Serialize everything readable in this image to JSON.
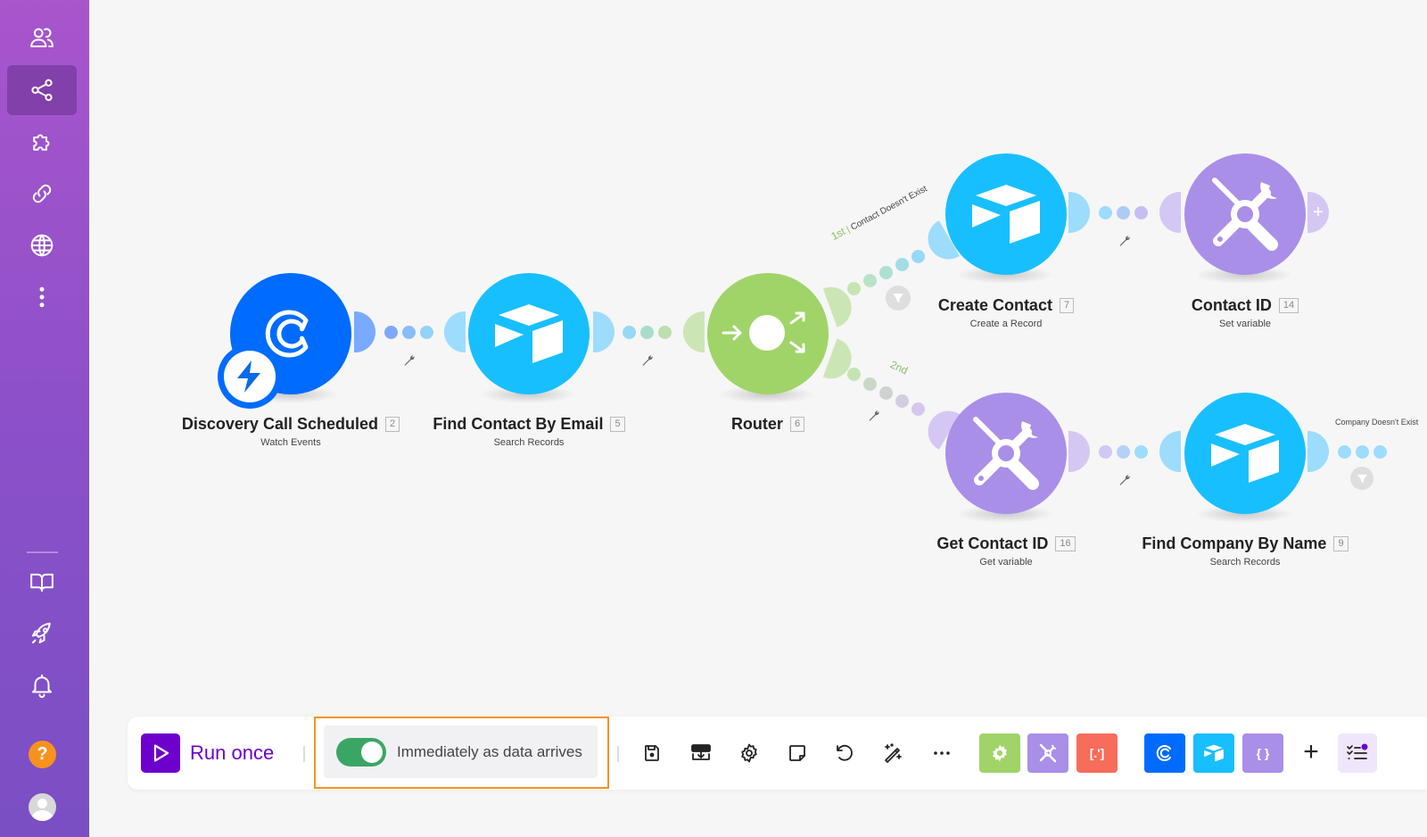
{
  "sidebar": {
    "items": [
      {
        "name": "team",
        "icon": "users-icon"
      },
      {
        "name": "scenarios",
        "icon": "share-icon",
        "active": true
      },
      {
        "name": "templates",
        "icon": "puzzle-icon"
      },
      {
        "name": "connections",
        "icon": "link-icon"
      },
      {
        "name": "webhooks",
        "icon": "globe-icon"
      },
      {
        "name": "more",
        "icon": "more-vertical-icon"
      }
    ],
    "bottom": [
      {
        "name": "docs",
        "icon": "book-icon"
      },
      {
        "name": "whats-new",
        "icon": "rocket-icon"
      },
      {
        "name": "notifications",
        "icon": "bell-icon"
      },
      {
        "name": "help",
        "icon": "help-icon",
        "label": "?"
      },
      {
        "name": "profile",
        "icon": "avatar-icon"
      }
    ]
  },
  "scenario": {
    "modules": [
      {
        "id": "discovery",
        "title": "Discovery Call Scheduled",
        "number": "2",
        "subtitle": "Watch Events",
        "app": "calendly",
        "color": "#006bff",
        "trigger": true
      },
      {
        "id": "find-contact",
        "title": "Find Contact By Email",
        "number": "5",
        "subtitle": "Search Records",
        "app": "airtable",
        "color": "#18bfff"
      },
      {
        "id": "router",
        "title": "Router",
        "number": "6",
        "subtitle": "",
        "app": "router",
        "color": "#a0d468"
      },
      {
        "id": "create-contact",
        "title": "Create Contact",
        "number": "7",
        "subtitle": "Create a Record",
        "app": "airtable",
        "color": "#18bfff"
      },
      {
        "id": "contact-id",
        "title": "Contact ID",
        "number": "14",
        "subtitle": "Set variable",
        "app": "tools",
        "color": "#a98fe8"
      },
      {
        "id": "get-contact-id",
        "title": "Get Contact ID",
        "number": "16",
        "subtitle": "Get variable",
        "app": "tools",
        "color": "#a98fe8"
      },
      {
        "id": "find-company",
        "title": "Find Company By Name",
        "number": "9",
        "subtitle": "Search Records",
        "app": "airtable",
        "color": "#18bfff"
      }
    ],
    "routes": [
      {
        "order": "1st",
        "label": "Contact Doesn't Exist"
      },
      {
        "order": "2nd",
        "label": ""
      }
    ],
    "filters": [
      {
        "label": "Company Doesn't Exist"
      }
    ]
  },
  "toolbar": {
    "run_once_label": "Run once",
    "schedule_label": "Immediately as data arrives",
    "schedule_enabled": true,
    "actions": [
      {
        "name": "save",
        "icon": "save-icon"
      },
      {
        "name": "blueprint",
        "icon": "import-icon"
      },
      {
        "name": "settings",
        "icon": "gear-icon"
      },
      {
        "name": "notes",
        "icon": "note-icon"
      },
      {
        "name": "undo",
        "icon": "undo-icon"
      },
      {
        "name": "auto-align",
        "icon": "magic-wand-icon"
      },
      {
        "name": "more",
        "icon": "more-horizontal-icon"
      }
    ],
    "modules": [
      {
        "name": "flow-control",
        "icon": "gear-icon",
        "color": "#a0d468"
      },
      {
        "name": "tools",
        "icon": "tools-icon",
        "color": "#a98fe8"
      },
      {
        "name": "text-parser",
        "icon": "parser-icon",
        "color": "#f76c5a",
        "label": "[.']"
      },
      {
        "name": "calendly",
        "icon": "calendly-icon",
        "color": "#006bff"
      },
      {
        "name": "airtable",
        "icon": "airtable-icon",
        "color": "#18bfff"
      },
      {
        "name": "json",
        "icon": "json-icon",
        "color": "#a98fe8",
        "label": "{ }"
      }
    ]
  }
}
